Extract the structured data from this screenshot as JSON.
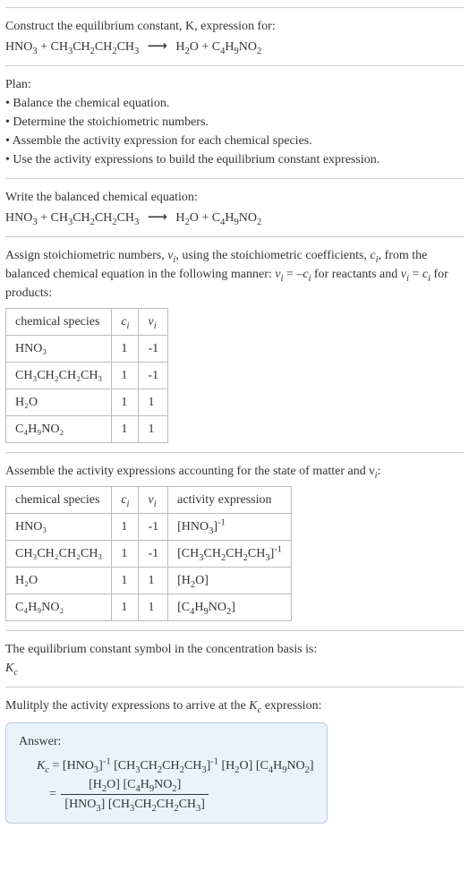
{
  "intro": {
    "line1": "Construct the equilibrium constant, K, expression for:",
    "eq_lhs1": "HNO",
    "eq_lhs1_sub": "3",
    "eq_plus1": " + CH",
    "eq_plus1_sub": "3",
    "eq_part2": "CH",
    "eq_part2_sub": "2",
    "eq_part3": "CH",
    "eq_part3_sub": "2",
    "eq_part4": "CH",
    "eq_part4_sub": "3",
    "arrow": "⟶",
    "eq_rhs1": " H",
    "eq_rhs1_sub": "2",
    "eq_rhs1b": "O + C",
    "eq_rhs2_sub": "4",
    "eq_rhs3": "H",
    "eq_rhs3_sub": "9",
    "eq_rhs4": "NO",
    "eq_rhs4_sub": "2"
  },
  "plan": {
    "title": "Plan:",
    "b1": "Balance the chemical equation.",
    "b2": "Determine the stoichiometric numbers.",
    "b3": "Assemble the activity expression for each chemical species.",
    "b4": "Use the activity expressions to build the equilibrium constant expression."
  },
  "balanced": {
    "title": "Write the balanced chemical equation:"
  },
  "assign": {
    "text1": "Assign stoichiometric numbers, ",
    "nu": "ν",
    "sub_i": "i",
    "text2": ", using the stoichiometric coefficients, ",
    "c": "c",
    "text3": ", from the balanced chemical equation in the following manner: ",
    "eq1a": "ν",
    "eq1b": " = –",
    "eq1c": "c",
    "text4": " for reactants and ",
    "eq2a": "ν",
    "eq2b": " = ",
    "eq2c": "c",
    "text5": " for products:"
  },
  "table1": {
    "h1": "chemical species",
    "h2": "c",
    "h2sub": "i",
    "h3": "ν",
    "h3sub": "i",
    "r1c1": "HNO₃",
    "r1c2": "1",
    "r1c3": "-1",
    "r2c1": "CH₃CH₂CH₂CH₃",
    "r2c2": "1",
    "r2c3": "-1",
    "r3c1": "H₂O",
    "r3c2": "1",
    "r3c3": "1",
    "r4c1": "C₄H₉NO₂",
    "r4c2": "1",
    "r4c3": "1"
  },
  "assemble": {
    "text": "Assemble the activity expressions accounting for the state of matter and ν",
    "sub": "i",
    "colon": ":"
  },
  "table2": {
    "h1": "chemical species",
    "h2": "c",
    "h2sub": "i",
    "h3": "ν",
    "h3sub": "i",
    "h4": "activity expression",
    "r1c1": "HNO₃",
    "r1c2": "1",
    "r1c3": "-1",
    "r1c4a": "[HNO",
    "r1c4sub": "3",
    "r1c4b": "]",
    "r1c4sup": "-1",
    "r2c1": "CH₃CH₂CH₂CH₃",
    "r2c2": "1",
    "r2c3": "-1",
    "r2c4a": "[CH",
    "r2c4b": "CH",
    "r2c4c": "CH",
    "r2c4d": "CH",
    "r2c4e": "]",
    "r2c4sup": "-1",
    "r3c1": "H₂O",
    "r3c2": "1",
    "r3c3": "1",
    "r3c4a": "[H",
    "r3c4sub": "2",
    "r3c4b": "O]",
    "r4c1": "C₄H₉NO₂",
    "r4c2": "1",
    "r4c3": "1",
    "r4c4a": "[C",
    "r4c4s1": "4",
    "r4c4b": "H",
    "r4c4s2": "9",
    "r4c4c": "NO",
    "r4c4s3": "2",
    "r4c4d": "]"
  },
  "kcsymbol": {
    "text": "The equilibrium constant symbol in the concentration basis is:",
    "kc": "K",
    "kcsub": "c"
  },
  "multiply": {
    "text": "Mulitply the activity expressions to arrive at the ",
    "k": "K",
    "ksub": "c",
    "text2": " expression:"
  },
  "answer": {
    "label": "Answer:",
    "kc": "K",
    "kcsub": "c",
    "eq": " = ",
    "term1a": "[HNO",
    "term1sub": "3",
    "term1b": "]",
    "term1sup": "-1",
    "term2a": " [CH",
    "s3": "3",
    "term2b": "CH",
    "s2": "2",
    "term2c": "CH",
    "term2d": "CH",
    "term2e": "]",
    "term2sup": "-1",
    "term3a": " [H",
    "term3b": "O]",
    "term4a": " [C",
    "s4": "4",
    "term4b": "H",
    "s9": "9",
    "term4c": "NO",
    "term4d": "]",
    "eq2": " = ",
    "num_a": "[H",
    "num_b": "O] [C",
    "num_c": "H",
    "num_d": "NO",
    "num_e": "]",
    "den_a": "[HNO",
    "den_b": "] [CH",
    "den_c": "CH",
    "den_d": "CH",
    "den_e": "CH",
    "den_f": "]"
  },
  "chart_data": {
    "type": "table",
    "title": "Stoichiometric and activity data",
    "tables": [
      {
        "columns": [
          "chemical species",
          "c_i",
          "ν_i"
        ],
        "rows": [
          [
            "HNO3",
            1,
            -1
          ],
          [
            "CH3CH2CH2CH3",
            1,
            -1
          ],
          [
            "H2O",
            1,
            1
          ],
          [
            "C4H9NO2",
            1,
            1
          ]
        ]
      },
      {
        "columns": [
          "chemical species",
          "c_i",
          "ν_i",
          "activity expression"
        ],
        "rows": [
          [
            "HNO3",
            1,
            -1,
            "[HNO3]^-1"
          ],
          [
            "CH3CH2CH2CH3",
            1,
            -1,
            "[CH3CH2CH2CH3]^-1"
          ],
          [
            "H2O",
            1,
            1,
            "[H2O]"
          ],
          [
            "C4H9NO2",
            1,
            1,
            "[C4H9NO2]"
          ]
        ]
      }
    ]
  }
}
